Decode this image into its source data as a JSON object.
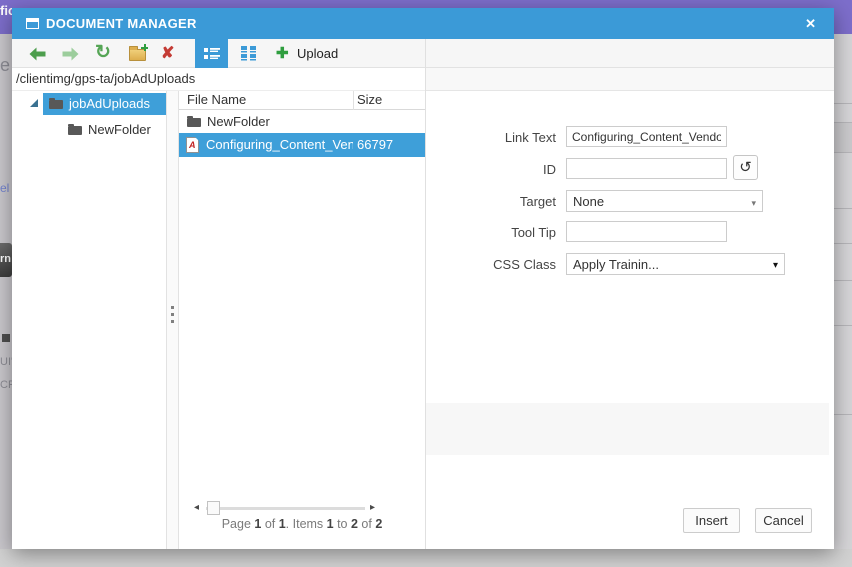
{
  "window": {
    "title": "DOCUMENT MANAGER"
  },
  "icons": {
    "close": "✕",
    "delete": "✘",
    "refresh": "↻",
    "regenerate": "↺",
    "dropdown": "▾",
    "scroll_left": "◂",
    "scroll_right": "▸",
    "upload_plus": "✚",
    "pdf_letter": "A"
  },
  "toolbar": {
    "upload_label": "Upload"
  },
  "breadcrumb": {
    "path": "/clientimg/gps-ta/jobAdUploads"
  },
  "tree": {
    "items": [
      {
        "label": "jobAdUploads",
        "selected": true
      },
      {
        "label": "NewFolder",
        "selected": false
      }
    ]
  },
  "grid": {
    "columns": [
      "File Name",
      "Size"
    ],
    "rows": [
      {
        "name": "NewFolder",
        "size": "",
        "type": "folder",
        "selected": false
      },
      {
        "name": "Configuring_Content_Vendor",
        "size": "66797",
        "type": "pdf",
        "selected": true
      }
    ],
    "pager_parts": [
      "Page ",
      "1",
      " of ",
      "1",
      ". Items ",
      "1",
      " to ",
      "2",
      " of ",
      "2"
    ]
  },
  "form": {
    "link_text": {
      "label": "Link Text",
      "value": "Configuring_Content_Vendor"
    },
    "id": {
      "label": "ID",
      "value": ""
    },
    "target": {
      "label": "Target",
      "value": "None"
    },
    "tool_tip": {
      "label": "Tool Tip",
      "value": ""
    },
    "css_class": {
      "label": "CSS Class",
      "value": "Apply Trainin..."
    }
  },
  "footer": {
    "insert_label": "Insert",
    "cancel_label": "Cancel"
  },
  "background": {
    "fragments": {
      "fic": "fic",
      "e": "e",
      "el": "el",
      "rn": "rn",
      "ui": "UI'",
      "cri": "CRI"
    }
  },
  "colors": {
    "titlebar_blue": "#3b9ad7",
    "selection_blue": "#3e9fd9",
    "purple": "#7d6ecb",
    "green": "#2f9e3f",
    "red": "#c43c35"
  }
}
